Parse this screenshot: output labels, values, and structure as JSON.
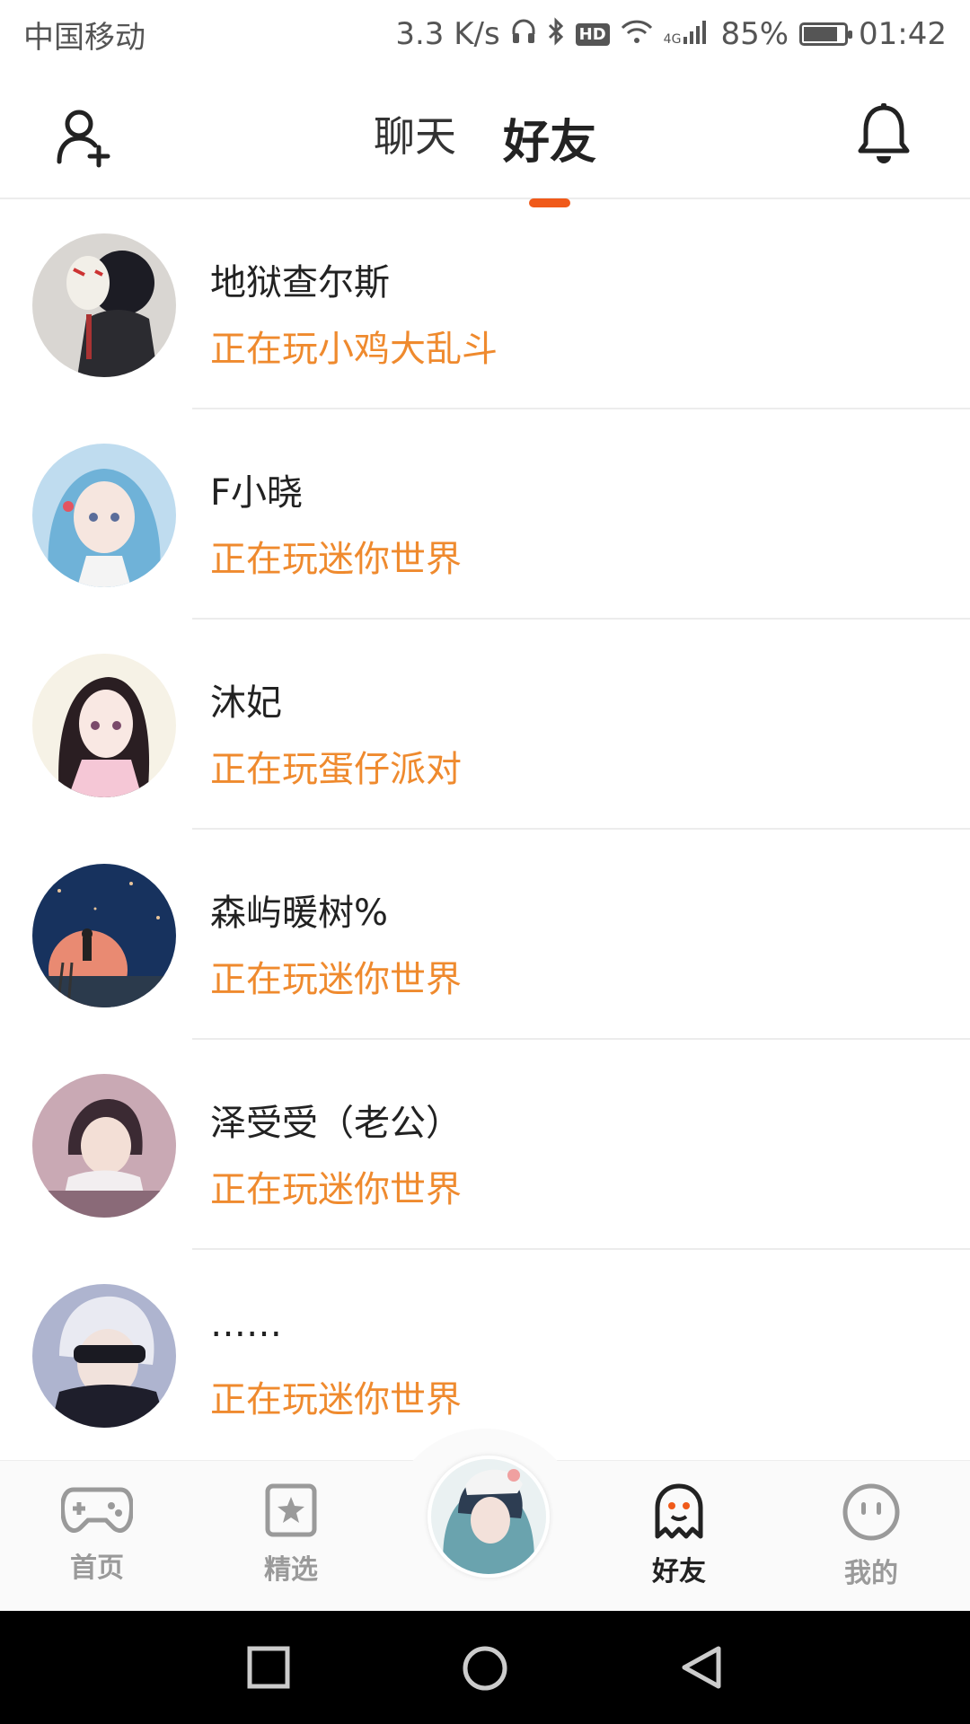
{
  "status_bar": {
    "carrier": "中国移动",
    "speed": "3.3 K/s",
    "hd": "HD",
    "network": "4G",
    "battery_percent": "85%",
    "battery_level": 0.85,
    "time": "01:42"
  },
  "header": {
    "tabs": [
      {
        "label": "聊天",
        "active": false
      },
      {
        "label": "好友",
        "active": true
      }
    ]
  },
  "friends": [
    {
      "name": "地狱查尔斯",
      "status": "正在玩小鸡大乱斗"
    },
    {
      "name": "F小晓",
      "status": "正在玩迷你世界"
    },
    {
      "name": "沐妃",
      "status": "正在玩蛋仔派对"
    },
    {
      "name": "森屿暖树%",
      "status": "正在玩迷你世界"
    },
    {
      "name": "泽受受（老公）",
      "status": "正在玩迷你世界"
    },
    {
      "name": "……",
      "status": "正在玩迷你世界"
    }
  ],
  "bottom_nav": {
    "items": [
      {
        "label": "首页",
        "icon": "gamepad-icon"
      },
      {
        "label": "精选",
        "icon": "star-card-icon"
      },
      {
        "label": "好友",
        "icon": "ghost-icon",
        "active": true
      },
      {
        "label": "我的",
        "icon": "smiley-icon"
      }
    ]
  },
  "colors": {
    "accent": "#f05a1a",
    "status_text": "#ef8a2e"
  }
}
